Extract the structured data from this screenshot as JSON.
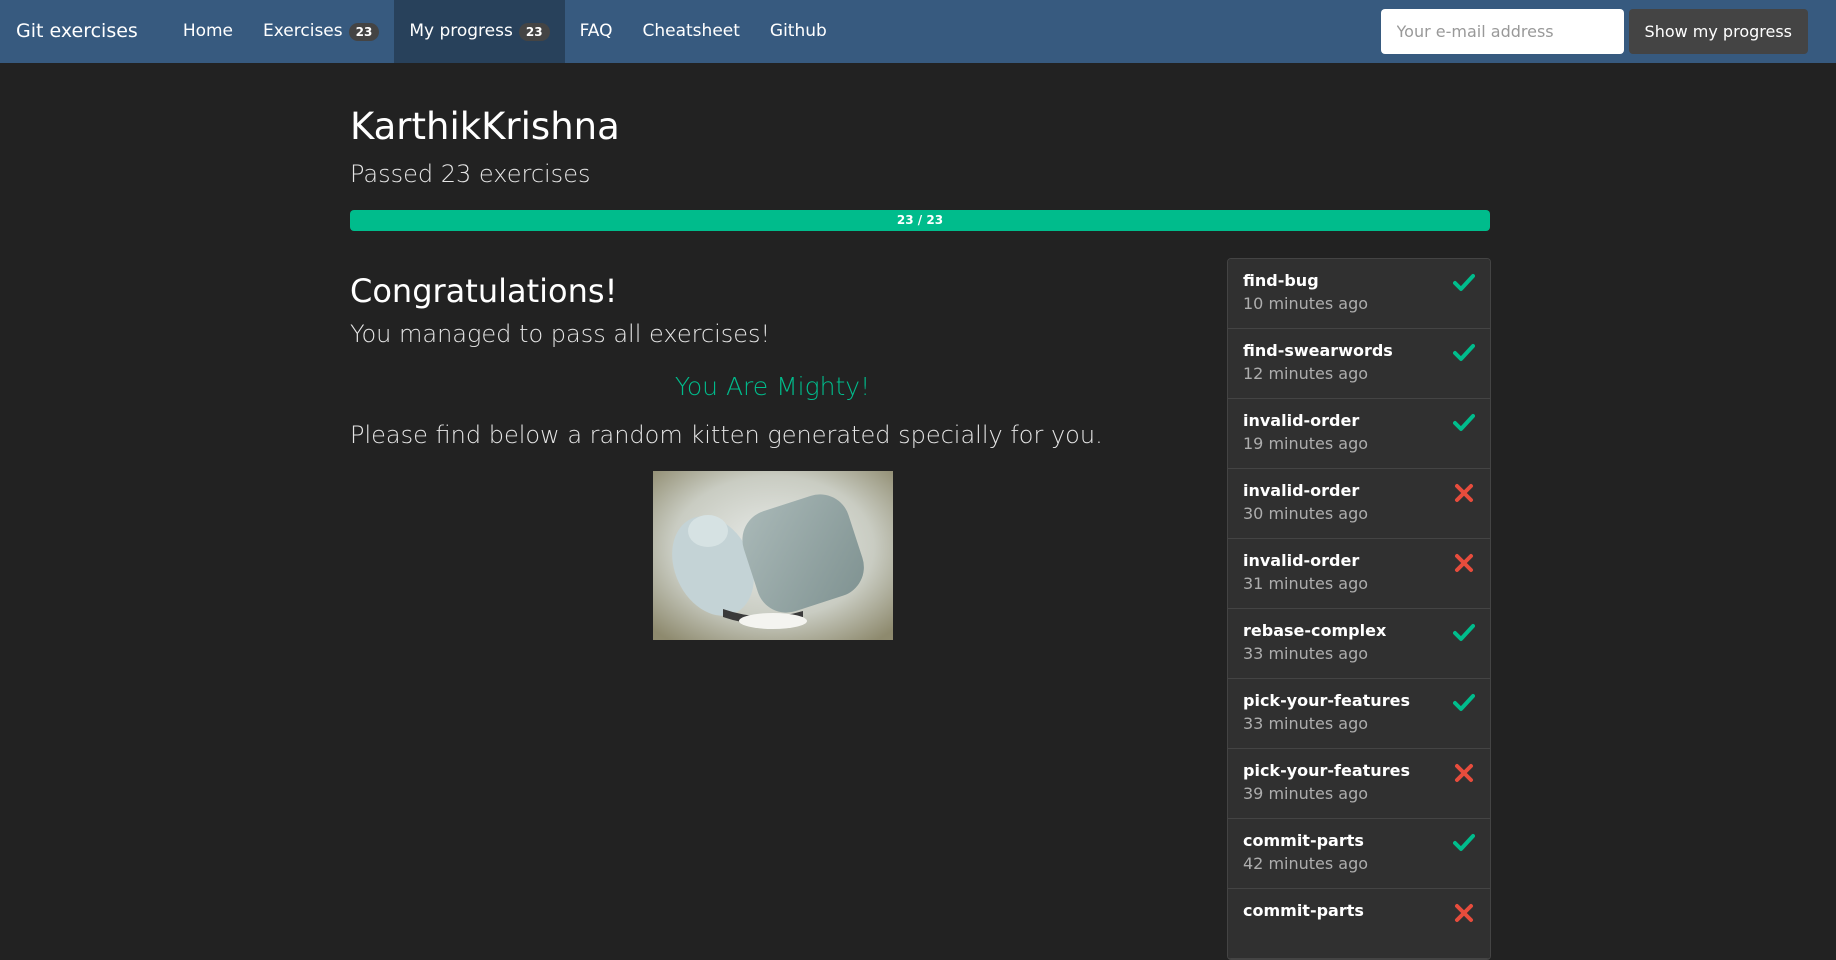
{
  "nav": {
    "brand": "Git exercises",
    "items": [
      {
        "label": "Home"
      },
      {
        "label": "Exercises",
        "badge": "23"
      },
      {
        "label": "My progress",
        "badge": "23"
      },
      {
        "label": "FAQ"
      },
      {
        "label": "Cheatsheet"
      },
      {
        "label": "Github"
      }
    ],
    "email_placeholder": "Your e-mail address",
    "show_button": "Show my progress"
  },
  "profile": {
    "username": "KarthikKrishna",
    "summary": "Passed 23 exercises",
    "progress_text": "23 / 23",
    "progress_fraction": 1.0
  },
  "congrats": {
    "title": "Congratulations!",
    "message": "You managed to pass all exercises!",
    "mighty": "You Are Mighty!",
    "kitten_text": "Please find below a random kitten generated specially for you."
  },
  "attempts": [
    {
      "name": "find-bug",
      "time": "10 minutes ago",
      "passed": true
    },
    {
      "name": "find-swearwords",
      "time": "12 minutes ago",
      "passed": true
    },
    {
      "name": "invalid-order",
      "time": "19 minutes ago",
      "passed": true
    },
    {
      "name": "invalid-order",
      "time": "30 minutes ago",
      "passed": false
    },
    {
      "name": "invalid-order",
      "time": "31 minutes ago",
      "passed": false
    },
    {
      "name": "rebase-complex",
      "time": "33 minutes ago",
      "passed": true
    },
    {
      "name": "pick-your-features",
      "time": "33 minutes ago",
      "passed": true
    },
    {
      "name": "pick-your-features",
      "time": "39 minutes ago",
      "passed": false
    },
    {
      "name": "commit-parts",
      "time": "42 minutes ago",
      "passed": true
    },
    {
      "name": "commit-parts",
      "time": "",
      "passed": false
    }
  ],
  "colors": {
    "navbar": "#375a7f",
    "success": "#00bc8c",
    "danger": "#e74c3c",
    "background": "#222222"
  }
}
